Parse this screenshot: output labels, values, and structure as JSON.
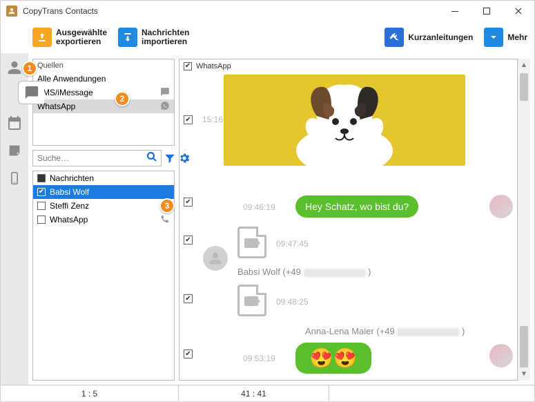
{
  "app": {
    "title": "CopyTrans Contacts"
  },
  "toolbar": {
    "export_label": "Ausgewählte\nexportieren",
    "import_label": "Nachrichten\nimportieren",
    "quick_label": "Kurzanleitungen",
    "more_label": "Mehr"
  },
  "sources": {
    "header": "Quellen",
    "items": [
      "Alle Anwendungen",
      "SMS/iMessage",
      "WhatsApp"
    ]
  },
  "search": {
    "placeholder": "Suche…"
  },
  "chats": {
    "header": "Nachrichten",
    "items": [
      "Babsi Wolf",
      "Steffi Zenz",
      "WhatsApp"
    ]
  },
  "conversation": {
    "title": "WhatsApp",
    "img_time": "15:16",
    "m1_time": "09:46:19",
    "m1_text": "Hey Schatz, wo bist du?",
    "m2_time": "09:47:45",
    "m2_sender_prefix": "Babsi Wolf (+49",
    "m3_time": "09:48:25",
    "m4_sender_prefix": "Anna-Lena Maier (+49",
    "m4_time": "09:53:19",
    "m4_emoji": "😍😍"
  },
  "status": {
    "left": "1 : 5",
    "mid": "41 : 41"
  },
  "badges": {
    "b1": "1",
    "b2": "2",
    "b3": "3"
  }
}
